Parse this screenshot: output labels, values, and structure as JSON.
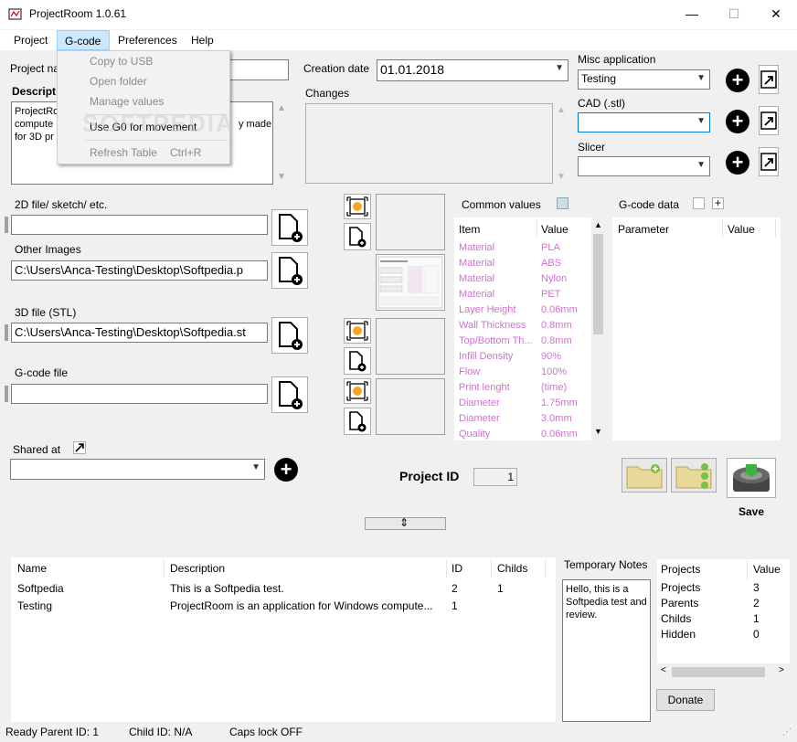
{
  "window": {
    "title": "ProjectRoom   1.0.61",
    "minimize_glyph": "—",
    "maximize_glyph": "☐",
    "close_glyph": "✕"
  },
  "menu": {
    "items": [
      "Project",
      "G-code",
      "Preferences",
      "Help"
    ],
    "dropdown": {
      "items": [
        "Copy to USB",
        "Open folder",
        "Manage values",
        "Use G0 for movement",
        "Refresh Table"
      ],
      "refresh_shortcut": "Ctrl+R"
    }
  },
  "project": {
    "name_label": "Project na",
    "description_label": "Descript",
    "description_text": [
      "ProjectRo",
      "compute",
      "for 3D pr"
    ],
    "description_tail": "y made",
    "creation_date_label": "Creation date",
    "creation_date_value": "01.01.2018",
    "changes_label": "Changes"
  },
  "apps": {
    "misc_label": "Misc application",
    "misc_value": "Testing",
    "cad_label": "CAD (.stl)",
    "cad_value": "",
    "slicer_label": "Slicer",
    "slicer_value": ""
  },
  "files": {
    "file2d_label": "2D file/ sketch/ etc.",
    "file2d_value": "",
    "other_images_label": "Other Images",
    "other_images_value": "C:\\Users\\Anca-Testing\\Desktop\\Softpedia.p",
    "stl_label": "3D file (STL)",
    "stl_value": "C:\\Users\\Anca-Testing\\Desktop\\Softpedia.st",
    "gcode_label": "G-code file",
    "gcode_value": "",
    "shared_label": "Shared at",
    "shared_value": ""
  },
  "common_values": {
    "label": "Common values",
    "headers": [
      "Item",
      "Value"
    ],
    "rows": [
      [
        "Material",
        "PLA"
      ],
      [
        "Material",
        "ABS"
      ],
      [
        "Material",
        "Nylon"
      ],
      [
        "Material",
        "PET"
      ],
      [
        "Layer Height",
        "0.06mm"
      ],
      [
        "Wall Thickness",
        "0.8mm"
      ],
      [
        "Top/Bottom Th...",
        "0.8mm"
      ],
      [
        "Infill Density",
        "90%"
      ],
      [
        "Flow",
        "100%"
      ],
      [
        "Print lenght",
        "(time)"
      ],
      [
        "Diameter",
        "1.75mm"
      ],
      [
        "Diameter",
        "3.0mm"
      ],
      [
        "Quality",
        "0.06mm"
      ]
    ]
  },
  "gcode_data": {
    "label": "G-code data",
    "headers": [
      "Parameter",
      "Value"
    ]
  },
  "project_id": {
    "label": "Project ID",
    "value": "1"
  },
  "save": {
    "label": "Save"
  },
  "projects_table": {
    "headers": [
      "Name",
      "Description",
      "ID",
      "Childs"
    ],
    "rows": [
      [
        "Softpedia",
        "This is a Softpedia test.",
        "2",
        "1"
      ],
      [
        "Testing",
        "ProjectRoom is an application for Windows compute...",
        "1",
        ""
      ]
    ]
  },
  "notes": {
    "label": "Temporary Notes",
    "text": "Hello, this is a Softpedia test and review."
  },
  "stats": {
    "headers": [
      "Projects",
      "Value"
    ],
    "rows": [
      [
        "Projects",
        "3"
      ],
      [
        "Parents",
        "2"
      ],
      [
        "Childs",
        "1"
      ],
      [
        "Hidden",
        "0"
      ]
    ]
  },
  "donate": {
    "label": "Donate"
  },
  "status": {
    "ready": "Ready",
    "parent": "Parent ID: 1",
    "child": "Child ID: N/A",
    "caps": "Caps lock OFF"
  },
  "watermark": "SOFTPEDIA",
  "colors": {
    "accent": "#0078d7",
    "menu_highlight": "#cce8ff",
    "grid_text": "#d070d0"
  }
}
